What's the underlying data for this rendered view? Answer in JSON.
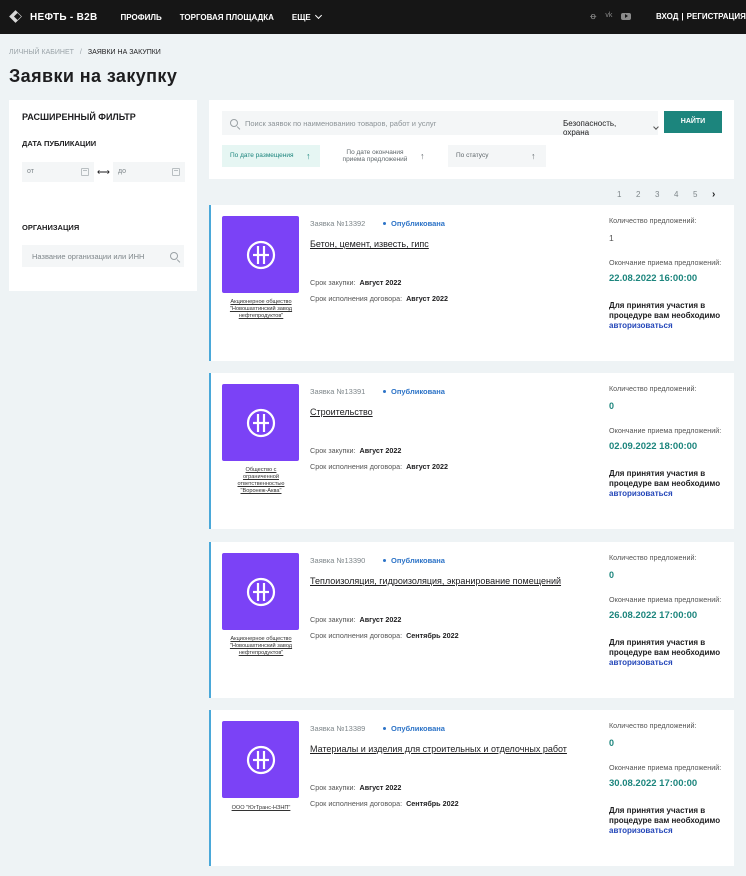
{
  "header": {
    "logo_text": "НЕФТЬ - B2B",
    "nav": [
      {
        "label": "ПРОФИЛЬ"
      },
      {
        "label": "ТОРГОВАЯ ПЛОЩАДКА"
      },
      {
        "label": "ЕЩЕ"
      }
    ],
    "social": [
      "ok-icon",
      "vk-icon",
      "youtube-icon"
    ],
    "login": "ВХОД",
    "separator": "|",
    "register": "РЕГИСТРАЦИЯ"
  },
  "breadcrumb": {
    "home": "ЛИЧНЫЙ КАБИНЕТ",
    "separator": "/",
    "current": "ЗАЯВКИ НА ЗАКУПКИ"
  },
  "page_title": "Заявки на закупку",
  "filter": {
    "title": "РАСШИРЕННЫЙ ФИЛЬТР",
    "date_label": "ДАТА ПУБЛИКАЦИИ",
    "date_from_placeholder": "от",
    "date_to_placeholder": "до",
    "range_arrow": "⟷",
    "org_label": "ОРГАНИЗАЦИЯ",
    "org_placeholder": "Название организации или ИНН"
  },
  "search": {
    "placeholder": "Поиск заявок по наименованию товаров, работ и услуг",
    "category": "Безопасность, охрана",
    "button": "НАЙТИ",
    "sort_options": [
      {
        "label": "По дате размещения",
        "active": true
      },
      {
        "label": "По дате окончания приема предложений",
        "active": false
      },
      {
        "label": "По статусу",
        "active": false
      }
    ],
    "sort_arrow": "↑"
  },
  "pagination": {
    "pages": [
      "1",
      "2",
      "3",
      "4",
      "5"
    ],
    "next": "›"
  },
  "labels": {
    "period": "Срок закупки:",
    "contract": "Срок исполнения договора:",
    "offers": "Количество предложений:",
    "deadline": "Окончание приема предложений:",
    "note": "Для принятия участия в процедуре вам необходимо",
    "auth_link": "авторизоваться"
  },
  "colors": {
    "accent": "#1c857d",
    "logo_bg": "#7b42f6",
    "status": "#2c73c7",
    "card_border": "#4aa8d9"
  },
  "requests": [
    {
      "number": "Заявка №13392",
      "status": "Опубликована",
      "title": "Бетон, цемент, известь, гипс",
      "org": "Акционерное общество \"Новошахтинский завод нефтепродуктов\"",
      "period": "Август 2022",
      "contract": "Август 2022",
      "offers": "1",
      "deadline": "22.08.2022 16:00:00"
    },
    {
      "number": "Заявка №13391",
      "status": "Опубликована",
      "title": "Строительство",
      "org": "Общество с ограниченной ответственностью \"Воронеж-Аква\"",
      "period": "Август 2022",
      "contract": "Август 2022",
      "offers": "0",
      "deadline": "02.09.2022 18:00:00"
    },
    {
      "number": "Заявка №13390",
      "status": "Опубликована",
      "title": "Теплоизоляция, гидроизоляция, экранирование помещений",
      "org": "Акционерное общество \"Новошахтинский завод нефтепродуктов\"",
      "period": "Август 2022",
      "contract": "Сентябрь 2022",
      "offers": "0",
      "deadline": "26.08.2022 17:00:00"
    },
    {
      "number": "Заявка №13389",
      "status": "Опубликована",
      "title": "Материалы и изделия для строительных и отделочных работ",
      "org": "ООО \"ЮгТранс-НЗНП\"",
      "period": "Август 2022",
      "contract": "Сентябрь 2022",
      "offers": "0",
      "deadline": "30.08.2022 17:00:00"
    }
  ]
}
